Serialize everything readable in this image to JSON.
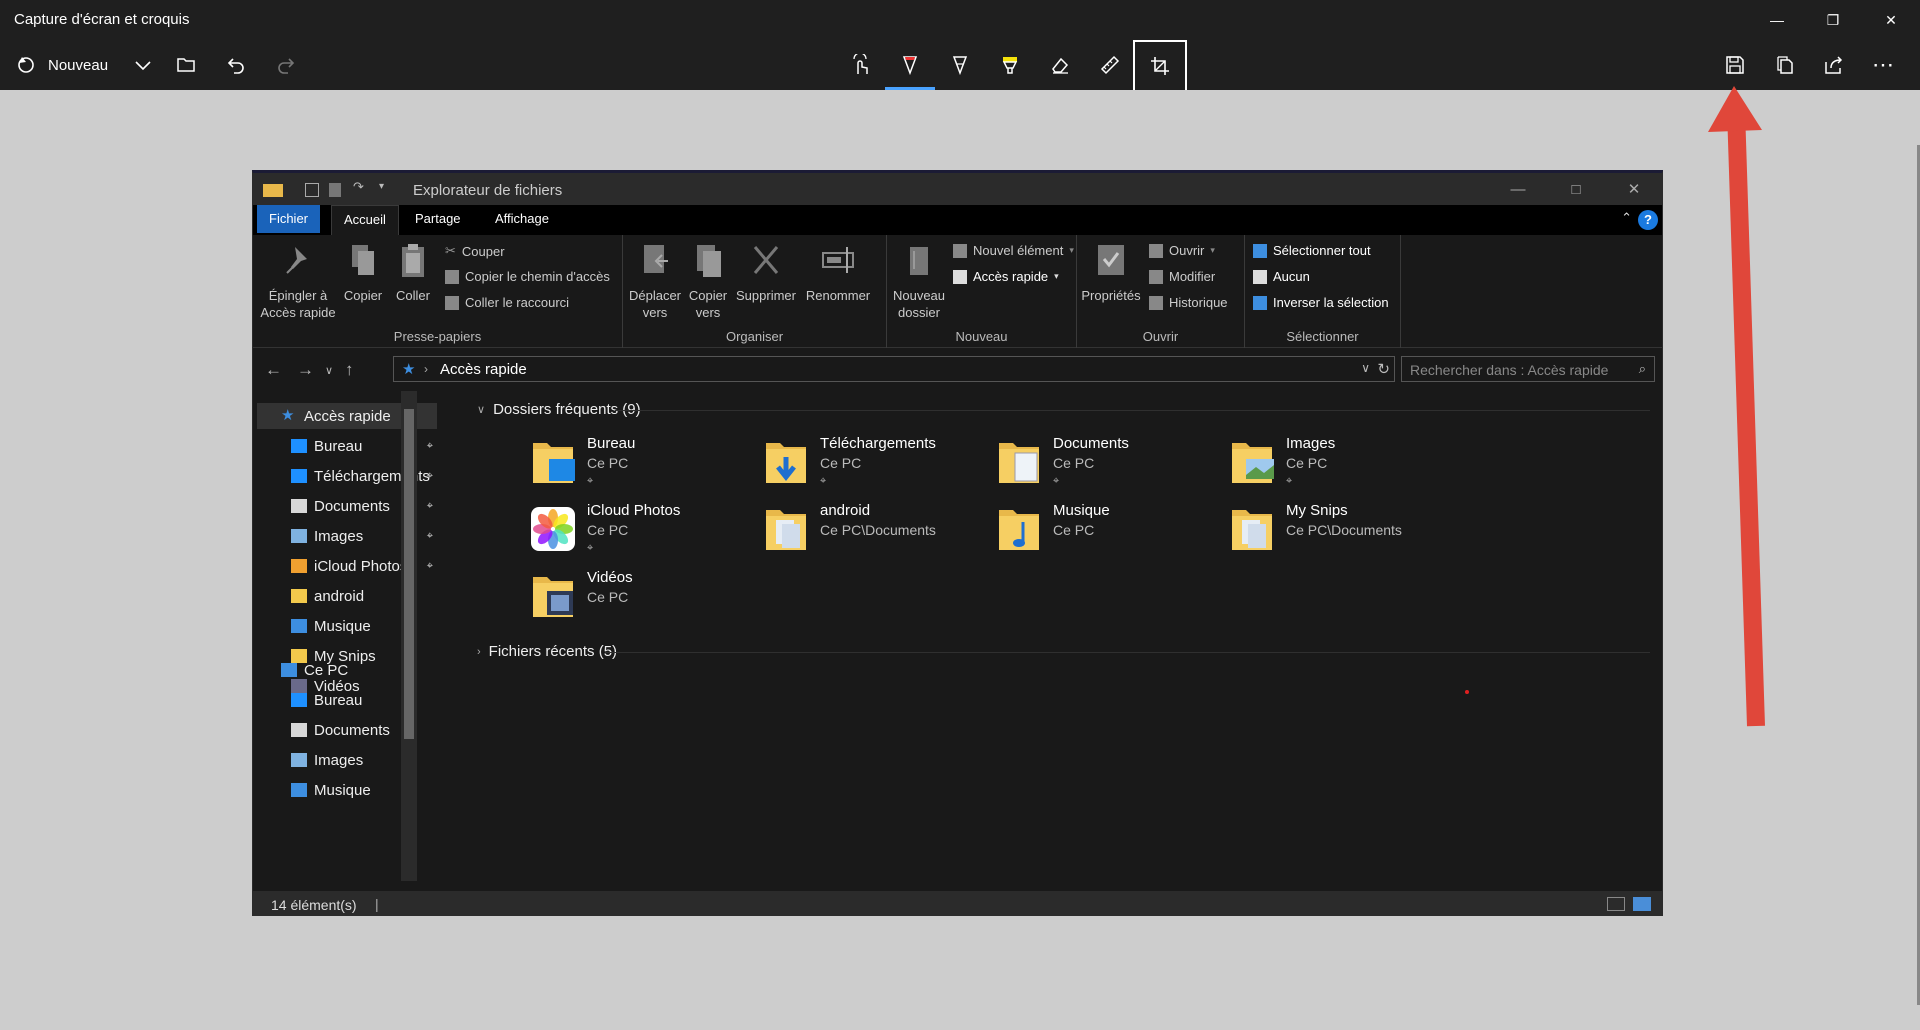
{
  "app": {
    "title": "Capture d'écran et croquis",
    "new_label": "Nouveau"
  },
  "explorer": {
    "title": "Explorateur de fichiers",
    "tabs": [
      "Fichier",
      "Accueil",
      "Partage",
      "Affichage"
    ],
    "help": "?",
    "ribbon": {
      "presse_papiers": {
        "label": "Presse-papiers",
        "pin": "Épingler à Accès rapide",
        "pin_line1": "Épingler à",
        "pin_line2": "Accès rapide",
        "copy": "Copier",
        "paste": "Coller",
        "cut": "Couper",
        "copy_path": "Copier le chemin d'accès",
        "paste_shortcut": "Coller le raccourci"
      },
      "organiser": {
        "label": "Organiser",
        "move_line1": "Déplacer",
        "move_line2": "vers",
        "copyto_line1": "Copier",
        "copyto_line2": "vers",
        "delete": "Supprimer",
        "rename": "Renommer"
      },
      "nouveau": {
        "label": "Nouveau",
        "newfolder_line1": "Nouveau",
        "newfolder_line2": "dossier",
        "new_item": "Nouvel élément",
        "easy_access": "Accès rapide"
      },
      "ouvrir": {
        "label": "Ouvrir",
        "properties": "Propriétés",
        "open": "Ouvrir",
        "edit": "Modifier",
        "history": "Historique"
      },
      "selectionner": {
        "label": "Sélectionner",
        "select_all": "Sélectionner tout",
        "select_none": "Aucun",
        "invert": "Inverser la sélection"
      }
    },
    "address": {
      "crumb": "Accès rapide",
      "search_placeholder": "Rechercher dans : Accès rapide"
    },
    "nav": {
      "quick_access": "Accès rapide",
      "pinned": [
        {
          "label": "Bureau",
          "pinned": true,
          "color": "#1e90ff"
        },
        {
          "label": "Téléchargements",
          "pinned": true,
          "color": "#1e90ff"
        },
        {
          "label": "Documents",
          "pinned": true,
          "color": "#d8d8d8"
        },
        {
          "label": "Images",
          "pinned": true,
          "color": "#7fb2e0"
        },
        {
          "label": "iCloud Photos",
          "pinned": true,
          "color": "#f0a030"
        },
        {
          "label": "android",
          "pinned": false,
          "color": "#f2c94c"
        },
        {
          "label": "Musique",
          "pinned": false,
          "color": "#3d8ee0"
        },
        {
          "label": "My Snips",
          "pinned": false,
          "color": "#f2c94c"
        },
        {
          "label": "Vidéos",
          "pinned": false,
          "color": "#6a6a8a"
        }
      ],
      "this_pc": "Ce PC",
      "pc_items": [
        {
          "label": "Bureau",
          "color": "#1e90ff"
        },
        {
          "label": "Documents",
          "color": "#d8d8d8"
        },
        {
          "label": "Images",
          "color": "#7fb2e0"
        },
        {
          "label": "Musique",
          "color": "#3d8ee0"
        }
      ]
    },
    "frequent": {
      "header": "Dossiers fréquents (9)",
      "items": [
        {
          "name": "Bureau",
          "location": "Ce PC",
          "pinned": true,
          "icon": "desktop-folder-icon"
        },
        {
          "name": "Téléchargements",
          "location": "Ce PC",
          "pinned": true,
          "icon": "downloads-folder-icon"
        },
        {
          "name": "Documents",
          "location": "Ce PC",
          "pinned": true,
          "icon": "documents-folder-icon"
        },
        {
          "name": "Images",
          "location": "Ce PC",
          "pinned": true,
          "icon": "pictures-folder-icon"
        },
        {
          "name": "iCloud Photos",
          "location": "Ce PC",
          "pinned": true,
          "icon": "icloud-photos-icon"
        },
        {
          "name": "android",
          "location": "Ce PC\\Documents",
          "pinned": false,
          "icon": "folder-icon"
        },
        {
          "name": "Musique",
          "location": "Ce PC",
          "pinned": false,
          "icon": "music-folder-icon"
        },
        {
          "name": "My Snips",
          "location": "Ce PC\\Documents",
          "pinned": false,
          "icon": "folder-icon"
        },
        {
          "name": "Vidéos",
          "location": "Ce PC",
          "pinned": false,
          "icon": "videos-folder-icon"
        }
      ]
    },
    "recent": {
      "header": "Fichiers récents (5)"
    },
    "status": {
      "count": "14 élément(s)"
    }
  },
  "colors": {
    "accent_blue": "#1a63ba",
    "annotation_red": "#e0473a"
  }
}
